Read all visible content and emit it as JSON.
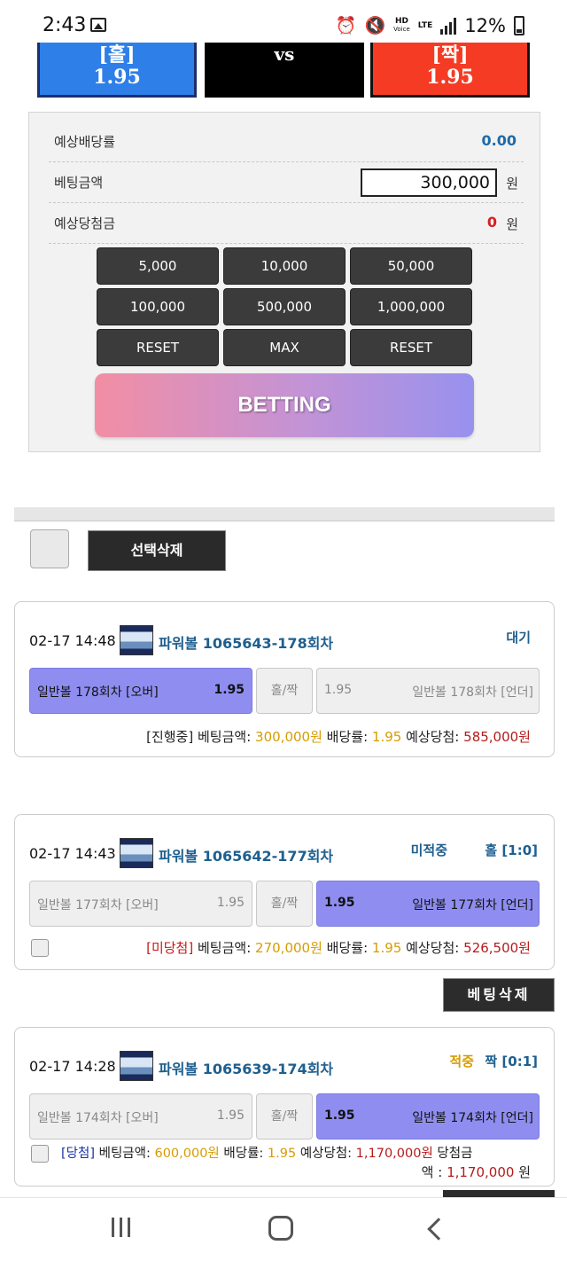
{
  "status_bar": {
    "time": "2:43",
    "network": "LTE",
    "hd_label": "HD",
    "voice_label": "Voice",
    "battery": "12%"
  },
  "choices": {
    "odd": {
      "label": "[홀]",
      "rate": "1.95"
    },
    "vs": "vs",
    "even": {
      "label": "[짝]",
      "rate": "1.95"
    }
  },
  "bet_form": {
    "expected_odds_label": "예상배당률",
    "expected_odds_value": "0.00",
    "bet_amount_label": "베팅금액",
    "bet_amount_value": "300,000",
    "unit": "원",
    "expected_win_label": "예상당첨금",
    "expected_win_value": "0",
    "quick_buttons": [
      "5,000",
      "10,000",
      "50,000",
      "100,000",
      "500,000",
      "1,000,000",
      "RESET",
      "MAX",
      "RESET"
    ],
    "betting_button": "BETTING"
  },
  "bulk": {
    "delete_selected": "선택삭제"
  },
  "bets": [
    {
      "time": "02-17 14:48",
      "game": "파워볼 1065643-178회차",
      "status": "대기",
      "status_color": "#1e5f8f",
      "result": "",
      "over_label": "일반볼 178회차 [오버]",
      "over_odds": "1.95",
      "mid_label": "홀/짝",
      "under_odds": "1.95",
      "under_label": "일반볼 178회차 [언더]",
      "selected": "over",
      "state_tag": "[진행중]",
      "amount_label": "베팅금액:",
      "amount": "300,000원",
      "odds_label": "배당률:",
      "odds": "1.95",
      "win_label": "예상당첨:",
      "win": "585,000원"
    },
    {
      "time": "02-17 14:43",
      "game": "파워볼 1065642-177회차",
      "status": "미적중",
      "status_color": "#1e5f8f",
      "result": "홀 [1:0]",
      "over_label": "일반볼 177회차 [오버]",
      "over_odds": "1.95",
      "mid_label": "홀/짝",
      "under_odds": "1.95",
      "under_label": "일반볼 177회차 [언더]",
      "selected": "under",
      "state_tag": "[미당첨]",
      "amount_label": "베팅금액:",
      "amount": "270,000원",
      "odds_label": "배당률:",
      "odds": "1.95",
      "win_label": "예상당첨:",
      "win": "526,500원"
    },
    {
      "time": "02-17 14:28",
      "game": "파워볼 1065639-174회차",
      "status": "적중",
      "status_color": "#d79c00",
      "result": "짝 [0:1]",
      "over_label": "일반볼 174회차 [오버]",
      "over_odds": "1.95",
      "mid_label": "홀/짝",
      "under_odds": "1.95",
      "under_label": "일반볼 174회차 [언더]",
      "selected": "under",
      "state_tag": "[당첨]",
      "amount_label": "베팅금액:",
      "amount": "600,000원",
      "odds_label": "배당률:",
      "odds": "1.95",
      "win_label": "예상당첨:",
      "win": "1,170,000원",
      "prize_label_1": "당첨금",
      "prize_label_2": "액 :",
      "prize": "1,170,000",
      "prize_unit": "원"
    }
  ],
  "bet_delete_button": "베팅삭제"
}
